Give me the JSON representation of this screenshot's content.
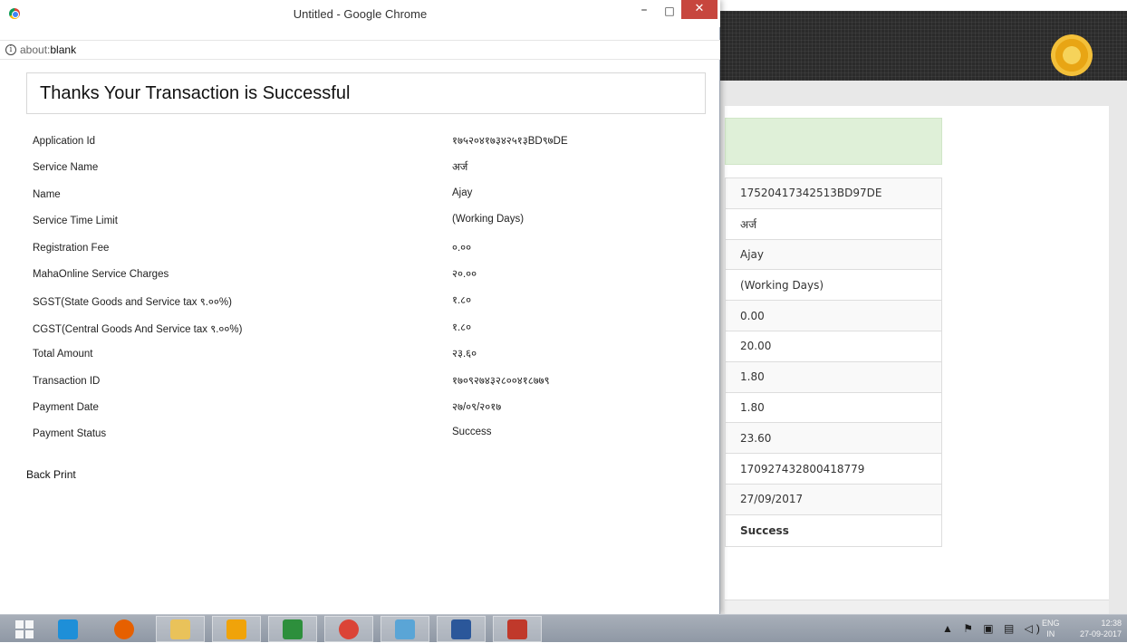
{
  "window": {
    "title": "Untitled - Google Chrome",
    "minimize_glyph": "–",
    "maximize_glyph": "□",
    "close_glyph": "✕"
  },
  "address_bar": {
    "info_glyph": "i",
    "prefix": "about:",
    "url": "blank"
  },
  "page": {
    "heading": "Thanks Your Transaction is Successful",
    "details": [
      {
        "label": "Application Id",
        "value": "१७५२०४१७३४२५१३BD९७DE"
      },
      {
        "label": "Service Name",
        "value": "अर्ज"
      },
      {
        "label": "Name",
        "value": "Ajay"
      },
      {
        "label": "Service Time Limit",
        "value": "(Working Days)"
      },
      {
        "label": "Registration Fee",
        "value": "०.००"
      },
      {
        "label": "MahaOnline Service Charges",
        "value": "२०.००"
      },
      {
        "label": "SGST(State Goods and Service tax ९.००%)",
        "value": "१.८०"
      },
      {
        "label": "CGST(Central Goods And Service tax ९.००%)",
        "value": "१.८०"
      },
      {
        "label": "Total Amount",
        "value": "२३.६०"
      },
      {
        "label": "Transaction ID",
        "value": "१७०९२७४३२८००४१८७७९"
      },
      {
        "label": "Payment Date",
        "value": "२७/०९/२०१७"
      },
      {
        "label": "Payment Status",
        "value": "Success"
      }
    ],
    "actions": {
      "back": "Back",
      "print": "Print"
    }
  },
  "background_page": {
    "rows": [
      "17520417342513BD97DE",
      "अर्ज",
      "Ajay",
      "(Working Days)",
      "0.00",
      "20.00",
      "1.80",
      "1.80",
      "23.60",
      "170927432800418779",
      "27/09/2017",
      "Success"
    ]
  },
  "taskbar": {
    "apps": [
      {
        "name": "start-button",
        "icon": "windows-logo-icon",
        "color": ""
      },
      {
        "name": "taskbar-ie",
        "icon": "internet-explorer-icon",
        "color": "#1e8fd8"
      },
      {
        "name": "taskbar-firefox",
        "icon": "firefox-icon",
        "color": "#e66000"
      },
      {
        "name": "taskbar-explorer",
        "icon": "file-explorer-icon",
        "color": "#e9c25a"
      },
      {
        "name": "taskbar-outlook",
        "icon": "outlook-icon",
        "color": "#f0a30a"
      },
      {
        "name": "taskbar-store",
        "icon": "store-icon",
        "color": "#2d8f3c"
      },
      {
        "name": "taskbar-chrome",
        "icon": "chrome-icon",
        "color": "#db4437"
      },
      {
        "name": "taskbar-app",
        "icon": "app-icon",
        "color": "#5aa5d6"
      },
      {
        "name": "taskbar-word",
        "icon": "word-icon",
        "color": "#2b579a"
      },
      {
        "name": "taskbar-snipping",
        "icon": "snipping-tool-icon",
        "color": "#c0392b"
      }
    ],
    "tray": {
      "icons": "▲ ⚑ ▣ ▤ ◁)",
      "lang_top": "ENG",
      "lang_bottom": "IN",
      "time": "12:38",
      "date": "27-09-2017"
    }
  }
}
